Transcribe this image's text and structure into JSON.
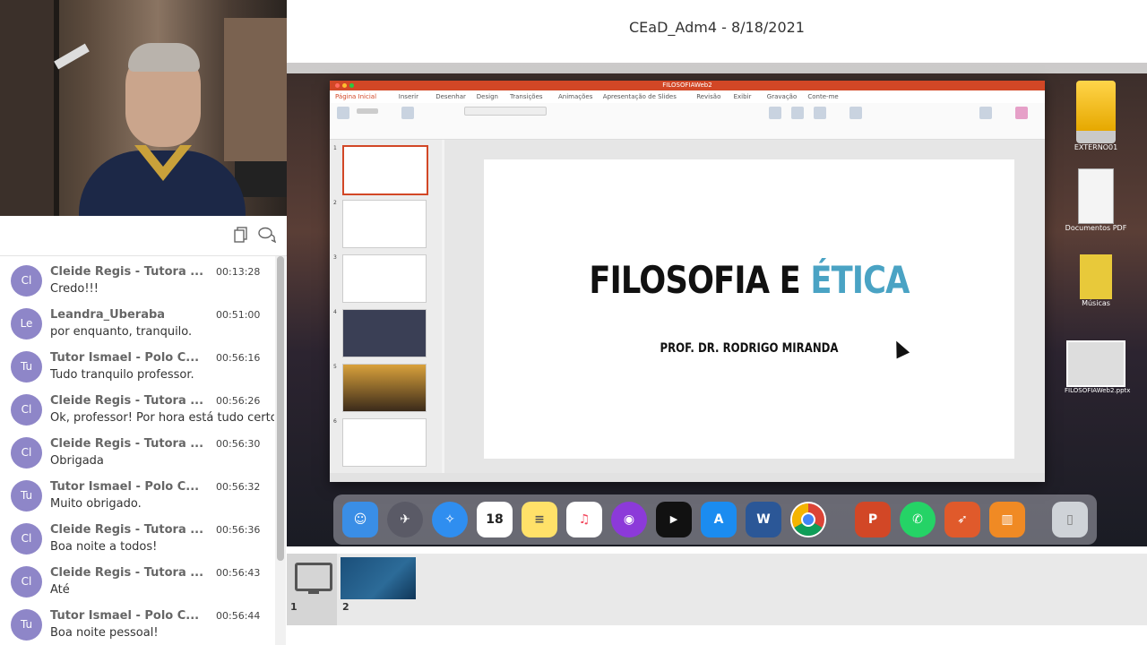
{
  "window_title": "CEaD_Adm4 - 8/18/2021",
  "chat": {
    "messages": [
      {
        "initials": "Cl",
        "name": "Cleide Regis - Tutora ...",
        "time": "00:13:28",
        "text": "Credo!!!"
      },
      {
        "initials": "Le",
        "name": "Leandra_Uberaba",
        "time": "00:51:00",
        "text": "por enquanto, tranquilo."
      },
      {
        "initials": "Tu",
        "name": "Tutor Ismael - Polo C...",
        "time": "00:56:16",
        "text": "Tudo tranquilo professor."
      },
      {
        "initials": "Cl",
        "name": "Cleide Regis - Tutora ...",
        "time": "00:56:26",
        "text": "Ok, professor! Por hora está tudo certo"
      },
      {
        "initials": "Cl",
        "name": "Cleide Regis - Tutora ...",
        "time": "00:56:30",
        "text": "Obrigada"
      },
      {
        "initials": "Tu",
        "name": "Tutor Ismael - Polo C...",
        "time": "00:56:32",
        "text": "Muito obrigado."
      },
      {
        "initials": "Cl",
        "name": "Cleide Regis - Tutora ...",
        "time": "00:56:36",
        "text": "Boa noite a todos!"
      },
      {
        "initials": "Cl",
        "name": "Cleide Regis - Tutora ...",
        "time": "00:56:43",
        "text": "Até"
      },
      {
        "initials": "Tu",
        "name": "Tutor Ismael - Polo C...",
        "time": "00:56:44",
        "text": "Boa noite pessoal!"
      }
    ]
  },
  "shared_screen": {
    "ppt_window_title": "FILOSOFIAWeb2",
    "ribbon_tabs": [
      "Página Inicial",
      "Inserir",
      "Desenhar",
      "Design",
      "Transições",
      "Animações",
      "Apresentação de Slides",
      "Revisão",
      "Exibir",
      "Gravação",
      "Conte-me"
    ],
    "slide_title_main": "FILOSOFIA E ",
    "slide_title_accent": "ÉTICA",
    "slide_subtitle": "PROF. DR. RODRIGO MIRANDA",
    "thumb_numbers": [
      "1",
      "2",
      "3",
      "4",
      "5",
      "6"
    ],
    "desktop_icons": [
      "EXTERNO01",
      "Documentos PDF",
      "Músicas",
      "FILOSOFIAWeb2.pptx"
    ],
    "dock_date": "18"
  },
  "video_strip": {
    "items": [
      {
        "label": "1"
      },
      {
        "label": "2"
      }
    ]
  },
  "colors": {
    "avatar": "#8e86c8",
    "ppt_accent": "#d24726",
    "slide_accent": "#4aa3c4"
  }
}
